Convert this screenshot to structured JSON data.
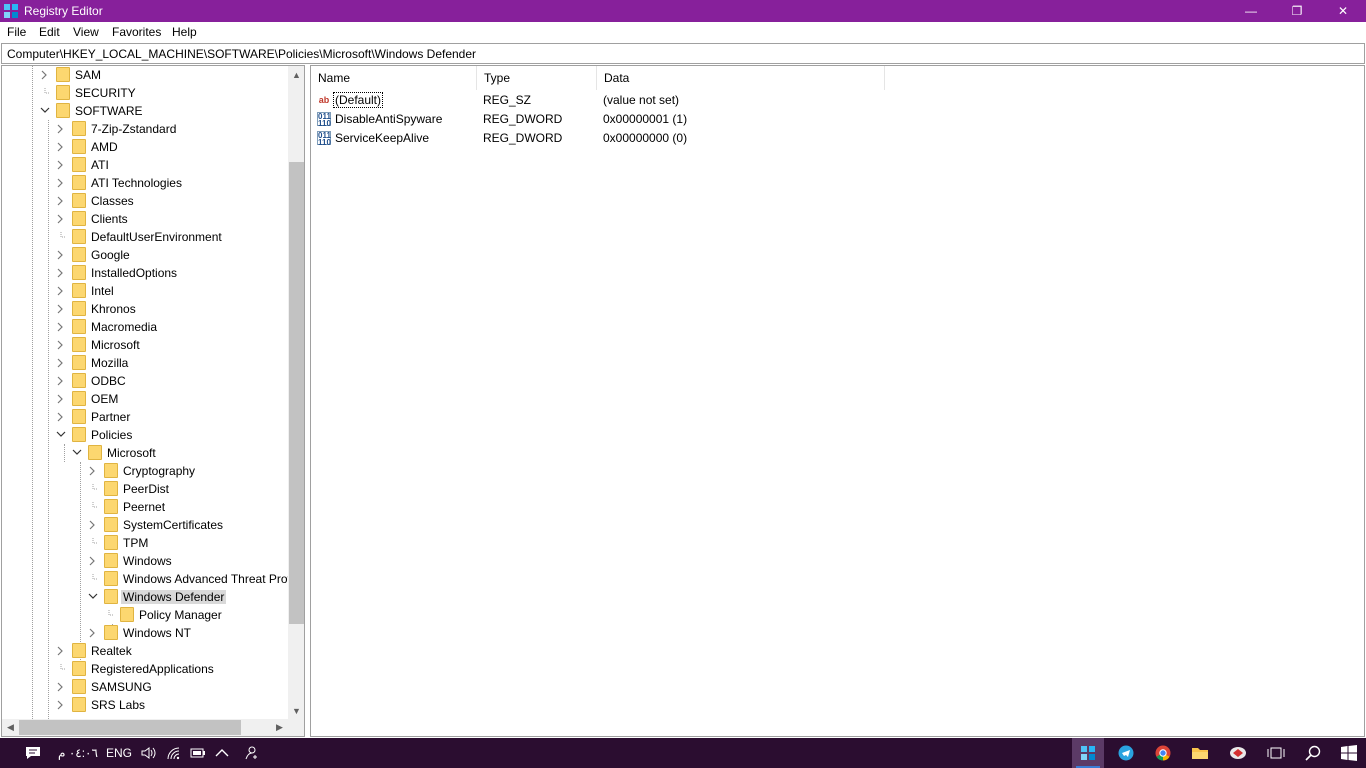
{
  "window": {
    "title": "Registry Editor",
    "minimize_glyph": "—",
    "restore_glyph": "❐",
    "close_glyph": "✕",
    "titlebar_color": "#87209b"
  },
  "menu": [
    "File",
    "Edit",
    "View",
    "Favorites",
    "Help"
  ],
  "address": "Computer\\HKEY_LOCAL_MACHINE\\SOFTWARE\\Policies\\Microsoft\\Windows Defender",
  "tree": {
    "nodes": [
      {
        "label": "SAM",
        "expander": ">"
      },
      {
        "label": "SECURITY",
        "expander": ""
      },
      {
        "label": "SOFTWARE",
        "expander": "v"
      },
      {
        "label": "7-Zip-Zstandard",
        "expander": ">"
      },
      {
        "label": "AMD",
        "expander": ">"
      },
      {
        "label": "ATI",
        "expander": ">"
      },
      {
        "label": "ATI Technologies",
        "expander": ">"
      },
      {
        "label": "Classes",
        "expander": ">"
      },
      {
        "label": "Clients",
        "expander": ">"
      },
      {
        "label": "DefaultUserEnvironment",
        "expander": ""
      },
      {
        "label": "Google",
        "expander": ">"
      },
      {
        "label": "InstalledOptions",
        "expander": ">"
      },
      {
        "label": "Intel",
        "expander": ">"
      },
      {
        "label": "Khronos",
        "expander": ">"
      },
      {
        "label": "Macromedia",
        "expander": ">"
      },
      {
        "label": "Microsoft",
        "expander": ">"
      },
      {
        "label": "Mozilla",
        "expander": ">"
      },
      {
        "label": "ODBC",
        "expander": ">"
      },
      {
        "label": "OEM",
        "expander": ">"
      },
      {
        "label": "Partner",
        "expander": ">"
      },
      {
        "label": "Policies",
        "expander": "v"
      },
      {
        "label": "Microsoft",
        "expander": "v"
      },
      {
        "label": "Cryptography",
        "expander": ">"
      },
      {
        "label": "PeerDist",
        "expander": ""
      },
      {
        "label": "Peernet",
        "expander": ""
      },
      {
        "label": "SystemCertificates",
        "expander": ">"
      },
      {
        "label": "TPM",
        "expander": ""
      },
      {
        "label": "Windows",
        "expander": ">"
      },
      {
        "label": "Windows Advanced Threat Prot",
        "expander": ""
      },
      {
        "label": "Windows Defender",
        "expander": "v",
        "selected": true
      },
      {
        "label": "Policy Manager",
        "expander": ""
      },
      {
        "label": "Windows NT",
        "expander": ">"
      },
      {
        "label": "Realtek",
        "expander": ">"
      },
      {
        "label": "RegisteredApplications",
        "expander": ""
      },
      {
        "label": "SAMSUNG",
        "expander": ">"
      },
      {
        "label": "SRS Labs",
        "expander": ">"
      }
    ]
  },
  "values": {
    "columns": [
      "Name",
      "Type",
      "Data"
    ],
    "rows": [
      {
        "icon": "string-value-icon",
        "glyph": "ab",
        "name": "(Default)",
        "type": "REG_SZ",
        "data": "(value not set)"
      },
      {
        "icon": "binary-value-icon",
        "glyph": "011\n110",
        "name": "DisableAntiSpyware",
        "type": "REG_DWORD",
        "data": "0x00000001 (1)"
      },
      {
        "icon": "binary-value-icon",
        "glyph": "011\n110",
        "name": "ServiceKeepAlive",
        "type": "REG_DWORD",
        "data": "0x00000000 (0)"
      }
    ]
  },
  "taskbar": {
    "background": "#2b0d30",
    "clock": "٠٤:٠٦ م",
    "language": "ENG",
    "accent": "#3a7bd5"
  }
}
